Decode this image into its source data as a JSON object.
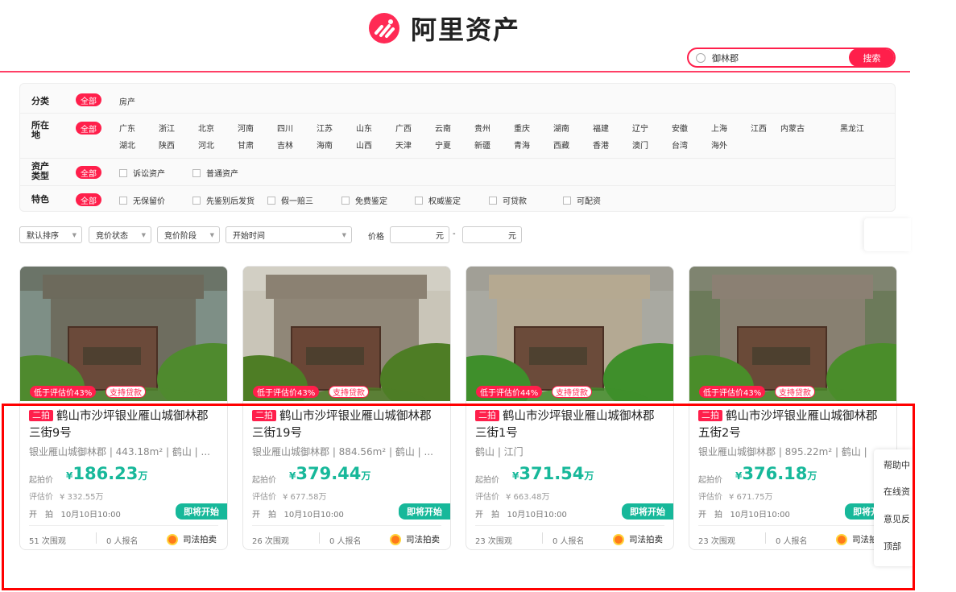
{
  "header": {
    "logo_text": "阿里资产",
    "search_value": "御林郡",
    "search_button": "搜索"
  },
  "filters": {
    "all_label": "全部",
    "category": {
      "label": "分类",
      "options": [
        "房产"
      ]
    },
    "location": {
      "label": "所在地",
      "row1": [
        "广东",
        "浙江",
        "北京",
        "河南",
        "四川",
        "江苏",
        "山东",
        "广西",
        "云南",
        "贵州",
        "重庆",
        "湖南",
        "福建",
        "辽宁",
        "安徽",
        "上海",
        "江西",
        "内蒙古",
        "黑龙江"
      ],
      "row2": [
        "湖北",
        "陕西",
        "河北",
        "甘肃",
        "吉林",
        "海南",
        "山西",
        "天津",
        "宁夏",
        "新疆",
        "青海",
        "西藏",
        "香港",
        "澳门",
        "台湾",
        "海外"
      ]
    },
    "asset_type": {
      "label": "资产类型",
      "options": [
        "诉讼资产",
        "普通资产"
      ]
    },
    "feature": {
      "label": "特色",
      "options": [
        "无保留价",
        "先鉴别后发货",
        "假一赔三",
        "免费鉴定",
        "权威鉴定",
        "可贷款",
        "可配资"
      ]
    }
  },
  "sortbar": {
    "default_sort": "默认排序",
    "bid_status": "竞价状态",
    "bid_stage": "竞价阶段",
    "start_time": "开始时间",
    "price_label": "价格",
    "yuan": "元",
    "dash": "-"
  },
  "card_labels": {
    "start_price": "起拍价",
    "eval_price": "评估价",
    "start_time": "开　拍",
    "coming_soon": "即将开始",
    "court": "司法拍卖",
    "currency": "¥",
    "wan": "万"
  },
  "cards": [
    {
      "badge_discount": "低于评估价43%",
      "badge_loan": "支持贷款",
      "round": "二拍",
      "title": "鹤山市沙坪银业雁山城御林郡三街9号",
      "subtitle": "银业雁山城御林郡 | 443.18m² | 鹤山 | ...",
      "price": "186.23",
      "eval": "¥ 332.55万",
      "time": "10月10日10:00",
      "views": "51 次围观",
      "signups": "0 人报名"
    },
    {
      "badge_discount": "低于评估价43%",
      "badge_loan": "支持贷款",
      "round": "二拍",
      "title": "鹤山市沙坪银业雁山城御林郡三街19号",
      "subtitle": "银业雁山城御林郡 | 884.56m² | 鹤山 | ...",
      "price": "379.44",
      "eval": "¥ 677.58万",
      "time": "10月10日10:00",
      "views": "26 次围观",
      "signups": "0 人报名"
    },
    {
      "badge_discount": "低于评估价44%",
      "badge_loan": "支持贷款",
      "round": "二拍",
      "title": "鹤山市沙坪银业雁山城御林郡三街1号",
      "subtitle": "鹤山 | 江门",
      "price": "371.54",
      "eval": "¥ 663.48万",
      "time": "10月10日10:00",
      "views": "23 次围观",
      "signups": "0 人报名"
    },
    {
      "badge_discount": "低于评估价43%",
      "badge_loan": "支持贷款",
      "round": "二拍",
      "title": "鹤山市沙坪银业雁山城御林郡五街2号",
      "subtitle": "银业雁山城御林郡 | 895.22m² | 鹤山 |",
      "price": "376.18",
      "eval": "¥ 671.75万",
      "time": "10月10日10:00",
      "views": "23 次围观",
      "signups": "0 人报名"
    }
  ],
  "sidebar": {
    "help": "帮助中",
    "online": "在线资",
    "feedback": "意见反",
    "top": "顶部"
  }
}
